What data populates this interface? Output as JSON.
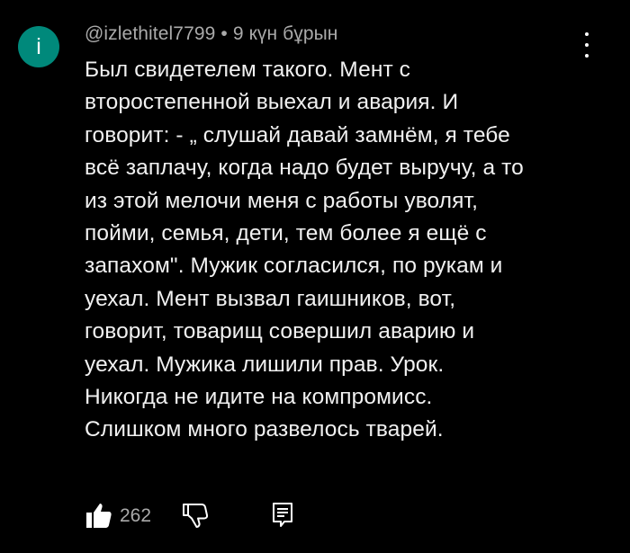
{
  "comment": {
    "avatar_letter": "i",
    "author": "@izlethitel7799",
    "separator": "•",
    "time": "9 күн бұрын",
    "text": "Был свидетелем такого. Мент с\nвторостепенной выехал и авария. И\nговорит: - „ слушай давай замнём, я тебе\nвсё заплачу, когда надо будет выручу, а то\nиз этой мелочи меня с работы уволят,\nпойми, семья, дети, тем более я ещё с\nзапахом\". Мужик согласился, по рукам и\nуехал. Мент вызвал гаишников, вот,\nговорит, товарищ совершил аварию и\nуехал. Мужика лишили прав. Урок.\nНикогда не идите на компромисс.\nСлишком много развелось тварей.",
    "like_count": "262"
  },
  "colors": {
    "background": "#000000",
    "avatar": "#00897b",
    "text": "#f1f1f1",
    "meta": "#aaaaaa"
  },
  "icons": {
    "more": "more-vert-icon",
    "like": "thumbs-up-icon",
    "dislike": "thumbs-down-icon",
    "reply": "reply-comment-icon"
  }
}
